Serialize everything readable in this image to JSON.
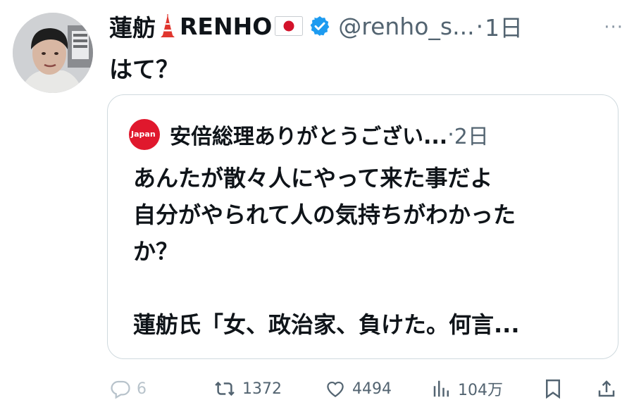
{
  "tweet": {
    "display_name": "蓮舫",
    "name_label": "RENHO",
    "handle": "@renho_s...",
    "separator": "·",
    "time": "1日",
    "more": "···",
    "text": "はて？",
    "icons": [
      "tokyo-tower-emoji",
      "japan-flag-emoji",
      "verified-badge-icon"
    ],
    "verified_color": "#1d9bf0"
  },
  "quote": {
    "logo_text": "Japan",
    "author": "安倍総理ありがとうござい...",
    "separator": "·",
    "time": "2日",
    "lines": [
      "あんたが散々人にやって来た事だよ",
      "自分がやられて人の気持ちがわかった",
      "か？",
      "蓮舫氏「女、政治家、負けた。何言..."
    ],
    "logo_color": "#e0182d"
  },
  "actions": {
    "reply_count": "6",
    "retweet_count": "1372",
    "like_count": "4494",
    "views_count": "104万",
    "icons": [
      "reply-icon",
      "retweet-icon",
      "like-icon",
      "views-icon",
      "bookmark-icon",
      "share-icon"
    ]
  }
}
